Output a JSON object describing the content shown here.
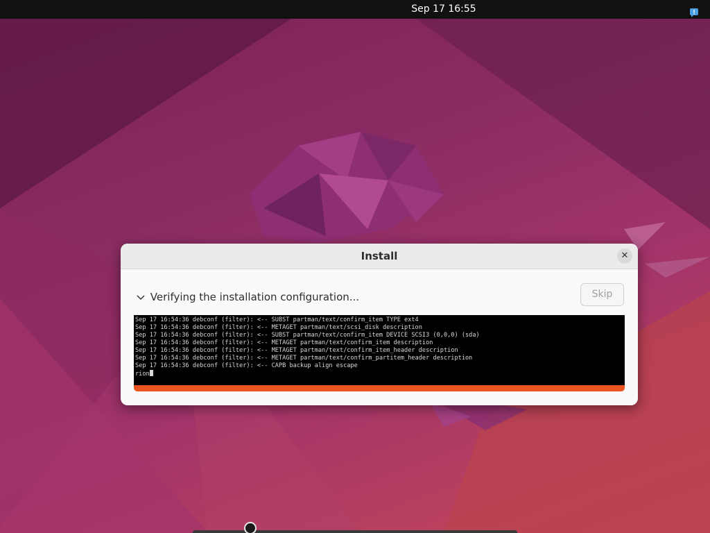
{
  "topbar": {
    "clock": "Sep 17  16:55",
    "notification_icon": "notification-bubble-icon"
  },
  "dialog": {
    "title": "Install",
    "close_icon": "close-icon",
    "status_text": "Verifying the installation configuration...",
    "skip_label": "Skip",
    "log_lines": [
      "Sep 17 16:54:36 debconf (filter): <-- SUBST partman/text/confirm_item TYPE ext4",
      "Sep 17 16:54:36 debconf (filter): <-- METAGET partman/text/scsi_disk description",
      "Sep 17 16:54:36 debconf (filter): <-- SUBST partman/text/confirm_item DEVICE SCSI3 (0,0,0) (sda)",
      "Sep 17 16:54:36 debconf (filter): <-- METAGET partman/text/confirm_item description",
      "Sep 17 16:54:36 debconf (filter): <-- METAGET partman/text/confirm_item_header description",
      "Sep 17 16:54:36 debconf (filter): <-- METAGET partman/text/confirm_partitem_header description",
      "Sep 17 16:54:36 debconf (filter): <-- CAPB backup align escape",
      "rion"
    ],
    "progress_fraction": 1.0
  },
  "colors": {
    "accent": "#e9541f",
    "terminal_bg": "#000000",
    "topbar_bg": "#111111"
  }
}
